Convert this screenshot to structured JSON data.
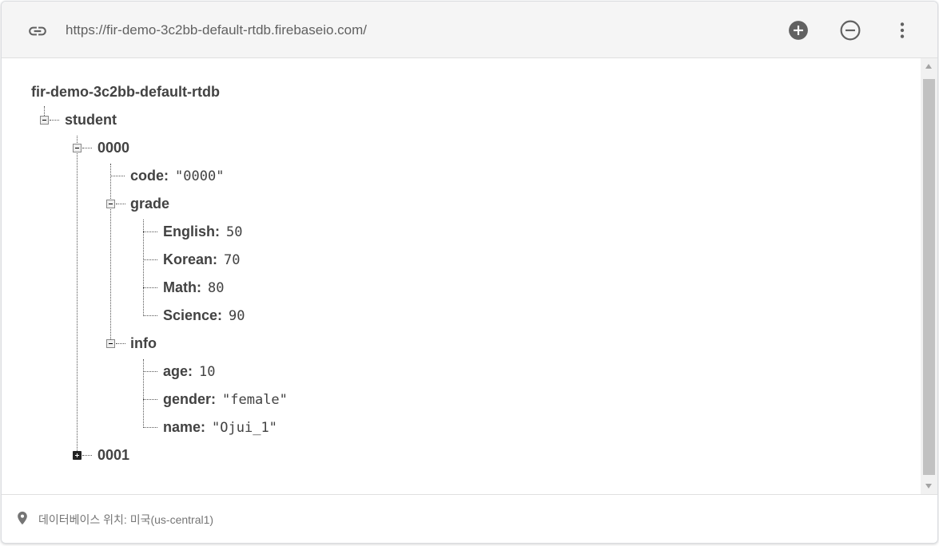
{
  "toolbar": {
    "url": "https://fir-demo-3c2bb-default-rtdb.firebaseio.com/",
    "icons": {
      "link": "link-icon",
      "add": "add-circle-icon",
      "remove": "remove-circle-icon",
      "more": "more-vert-icon"
    }
  },
  "tree": {
    "root": "fir-demo-3c2bb-default-rtdb",
    "student": "student",
    "n0000": "0000",
    "code": {
      "key": "code",
      "value": "\"0000\""
    },
    "grade": "grade",
    "english": {
      "key": "English",
      "value": "50"
    },
    "korean": {
      "key": "Korean",
      "value": "70"
    },
    "math": {
      "key": "Math",
      "value": "80"
    },
    "science": {
      "key": "Science",
      "value": "90"
    },
    "info": "info",
    "age": {
      "key": "age",
      "value": "10"
    },
    "gender": {
      "key": "gender",
      "value": "\"female\""
    },
    "name": {
      "key": "name",
      "value": "\"Ojui_1\""
    },
    "n0001": "0001",
    "colon": ":"
  },
  "footer": {
    "location": "데이터베이스 위치: 미국(us-central1)",
    "icon": "location-pin-icon"
  }
}
